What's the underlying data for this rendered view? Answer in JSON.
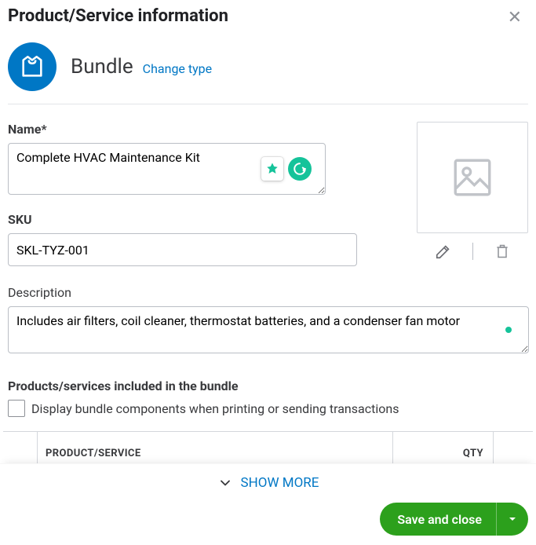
{
  "header": {
    "title": "Product/Service information"
  },
  "type": {
    "name": "Bundle",
    "change_label": "Change type",
    "icon": "tshirt-icon"
  },
  "fields": {
    "name_label": "Name*",
    "name_value": "Complete HVAC Maintenance Kit",
    "sku_label": "SKU",
    "sku_value": "SKL-TYZ-001",
    "description_label": "Description",
    "description_value": "Includes air filters, coil cleaner, thermostat batteries, and a condenser fan motor"
  },
  "bundle": {
    "section_label": "Products/services included in the bundle",
    "display_components_label": "Display bundle components when printing or sending transactions",
    "display_components_checked": false,
    "columns": {
      "product": "PRODUCT/SERVICE",
      "qty": "QTY"
    }
  },
  "show_more_label": "SHOW MORE",
  "footer": {
    "save_label": "Save and close"
  },
  "colors": {
    "primary_blue": "#0077c5",
    "brand_green": "#2ca01c",
    "grammarly_green": "#15c39a"
  }
}
